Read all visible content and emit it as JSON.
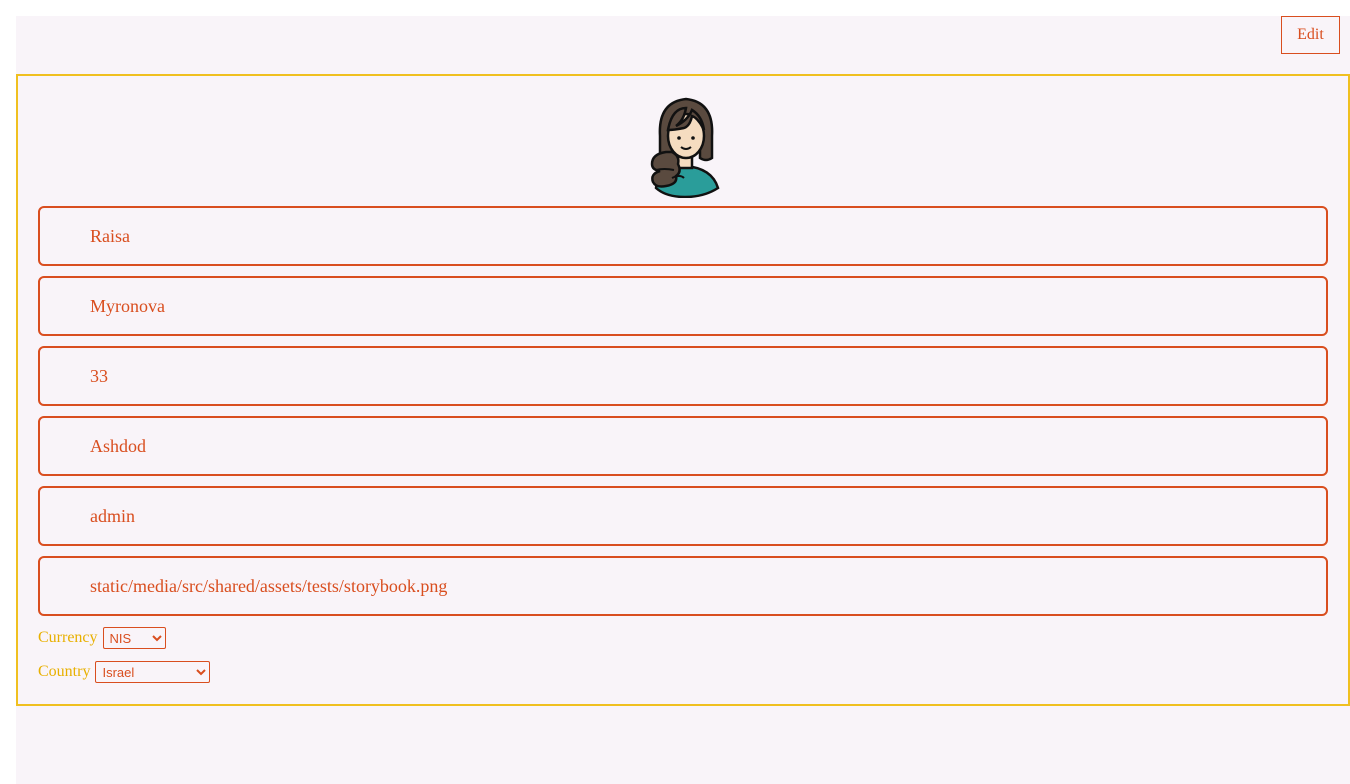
{
  "toolbar": {
    "edit_label": "Edit"
  },
  "profile": {
    "avatar_icon": "woman-avatar-icon",
    "fields": [
      {
        "name": "first-name-field",
        "value": "Raisa"
      },
      {
        "name": "last-name-field",
        "value": "Myronova"
      },
      {
        "name": "age-field",
        "value": "33"
      },
      {
        "name": "city-field",
        "value": "Ashdod"
      },
      {
        "name": "role-field",
        "value": "admin"
      },
      {
        "name": "avatar-path-field",
        "value": "static/media/src/shared/assets/tests/storybook.png"
      }
    ],
    "currency": {
      "label": "Currency",
      "selected": "NIS",
      "options": [
        "NIS"
      ]
    },
    "country": {
      "label": "Country",
      "selected": "Israel",
      "options": [
        "Israel"
      ]
    }
  },
  "colors": {
    "accent": "#d94e1f",
    "card_border": "#f0c020",
    "label_yellow": "#e8b000",
    "background": "#f9f4f9"
  }
}
